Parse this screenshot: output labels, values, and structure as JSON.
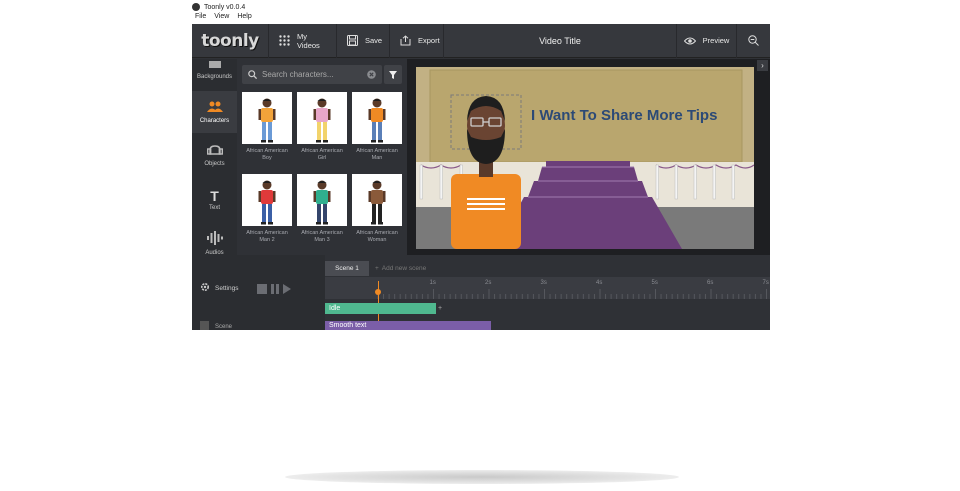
{
  "window": {
    "title": "Toonly v0.0.4"
  },
  "menu": [
    "File",
    "View",
    "Help"
  ],
  "toolbar": {
    "logo": "toonly",
    "my_videos": "My Videos",
    "save": "Save",
    "export": "Export",
    "video_title": "Video Title",
    "preview": "Preview"
  },
  "sidenav": {
    "items": [
      {
        "label": "Backgrounds",
        "icon": "backgrounds-icon"
      },
      {
        "label": "Characters",
        "icon": "characters-icon",
        "active": true
      },
      {
        "label": "Objects",
        "icon": "objects-icon"
      },
      {
        "label": "Text",
        "icon": "text-icon"
      },
      {
        "label": "Audios",
        "icon": "audio-icon"
      }
    ]
  },
  "search": {
    "placeholder": "Search characters..."
  },
  "characters": [
    {
      "label": "African American Boy",
      "shirt": "#f2a33a",
      "pants": "#6a9ad6"
    },
    {
      "label": "African American Girl",
      "shirt": "#e8a7c9",
      "pants": "#f2d36b"
    },
    {
      "label": "African American Man",
      "shirt": "#f08a24",
      "pants": "#5a7fb8"
    },
    {
      "label": "African American Man 2",
      "shirt": "#e03a3a",
      "pants": "#3b5fa6"
    },
    {
      "label": "African American Man 3",
      "shirt": "#2faf8e",
      "pants": "#34456b"
    },
    {
      "label": "African American Woman",
      "shirt": "#8a5a3a",
      "pants": "#222222"
    }
  ],
  "canvas": {
    "scene_text": "I Want To Share More Tips"
  },
  "timeline": {
    "scene_tab": "Scene 1",
    "add_scene": "Add new scene",
    "settings": "Settings",
    "ticks": [
      "1s",
      "2s",
      "3s",
      "4s",
      "5s",
      "6s",
      "7s",
      "8s"
    ],
    "tracks": {
      "idle": "Idle",
      "smooth": "Smooth text",
      "scene": "Scene"
    }
  },
  "colors": {
    "accent": "#f08a24",
    "idle_track": "#4fb88f",
    "text_track": "#7b5ea8",
    "active_nav_icon": "#f08a24"
  }
}
